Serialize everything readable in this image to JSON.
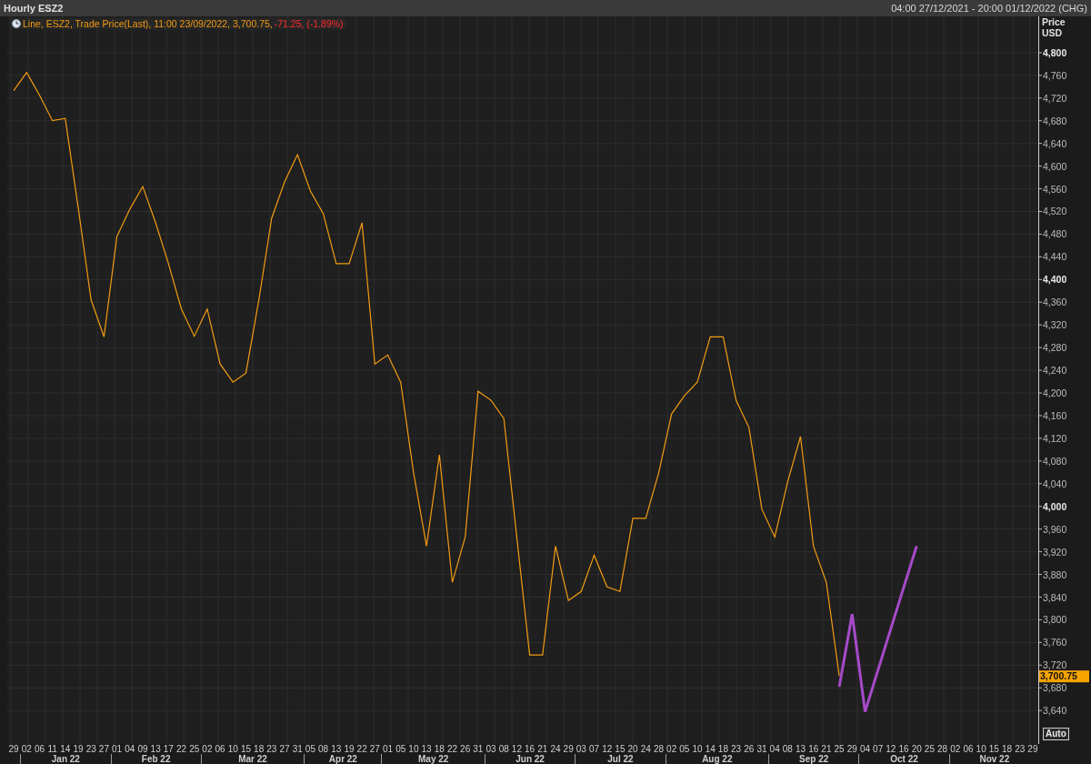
{
  "title_bar": {
    "title": "Hourly ESZ2",
    "range": "04:00 27/12/2021 - 20:00 01/12/2022 (CHG)"
  },
  "legend": {
    "text": "Line, ESZ2, Trade Price(Last),  11:00 23/09/2022, 3,700.75,",
    "change": "-71.25, (-1.89%)"
  },
  "axis_header": [
    "Price",
    "USD"
  ],
  "price_tag": "3,700.75",
  "auto_button": "Auto",
  "chart_data": {
    "type": "line",
    "grid": true,
    "ylim": [
      3581,
      4864
    ],
    "yticks": [
      {
        "value": 4800,
        "label": "4,800"
      },
      {
        "value": 4760,
        "label": "4,760"
      },
      {
        "value": 4720,
        "label": "4,720"
      },
      {
        "value": 4680,
        "label": "4,680"
      },
      {
        "value": 4640,
        "label": "4,640"
      },
      {
        "value": 4600,
        "label": "4,600"
      },
      {
        "value": 4560,
        "label": "4,560"
      },
      {
        "value": 4520,
        "label": "4,520"
      },
      {
        "value": 4480,
        "label": "4,480"
      },
      {
        "value": 4440,
        "label": "4,440"
      },
      {
        "value": 4400,
        "label": "4,400"
      },
      {
        "value": 4360,
        "label": "4,360"
      },
      {
        "value": 4320,
        "label": "4,320"
      },
      {
        "value": 4280,
        "label": "4,280"
      },
      {
        "value": 4240,
        "label": "4,240"
      },
      {
        "value": 4200,
        "label": "4,200"
      },
      {
        "value": 4160,
        "label": "4,160"
      },
      {
        "value": 4120,
        "label": "4,120"
      },
      {
        "value": 4080,
        "label": "4,080"
      },
      {
        "value": 4040,
        "label": "4,040"
      },
      {
        "value": 4000,
        "label": "4,000"
      },
      {
        "value": 3960,
        "label": "3,960"
      },
      {
        "value": 3920,
        "label": "3,920"
      },
      {
        "value": 3880,
        "label": "3,880"
      },
      {
        "value": 3840,
        "label": "3,840"
      },
      {
        "value": 3800,
        "label": "3,800"
      },
      {
        "value": 3760,
        "label": "3,760"
      },
      {
        "value": 3720,
        "label": "3,720"
      },
      {
        "value": 3680,
        "label": "3,680"
      },
      {
        "value": 3640,
        "label": "3,640"
      }
    ],
    "categories": [
      "29",
      "02",
      "06",
      "11",
      "14",
      "19",
      "23",
      "27",
      "01",
      "04",
      "09",
      "13",
      "17",
      "22",
      "25",
      "02",
      "06",
      "10",
      "15",
      "18",
      "23",
      "27",
      "31",
      "05",
      "08",
      "13",
      "19",
      "22",
      "27",
      "01",
      "05",
      "10",
      "13",
      "18",
      "22",
      "26",
      "31",
      "03",
      "08",
      "12",
      "16",
      "21",
      "24",
      "29",
      "03",
      "07",
      "12",
      "15",
      "20",
      "24",
      "28",
      "02",
      "05",
      "10",
      "14",
      "18",
      "23",
      "26",
      "31",
      "04",
      "08",
      "13",
      "16",
      "21",
      "25",
      "29",
      "04",
      "07",
      "12",
      "16",
      "20",
      "25",
      "28",
      "02",
      "06",
      "10",
      "15",
      "18",
      "23",
      "29"
    ],
    "series": [
      {
        "color": "#f39c12",
        "values": [
          4733,
          4765,
          4725,
          4680,
          4684,
          4527,
          4364,
          4299,
          4476,
          4524,
          4564,
          4500,
          4428,
          4348,
          4300,
          4348,
          4251,
          4219,
          4235,
          4364,
          4508,
          4572,
          4620,
          4556,
          4516,
          4428,
          4428,
          4500,
          4251,
          4267,
          4219,
          4059,
          3930,
          4091,
          3866,
          3946,
          4203,
          4187,
          4155,
          3946,
          3738,
          3738,
          3930,
          3834,
          3850,
          3914,
          3858,
          3850,
          3979,
          3979,
          4059,
          4163,
          4195,
          4219,
          4299,
          4299,
          4187,
          4139,
          3995,
          3946,
          4043,
          4123,
          3930,
          3866,
          3701,
          null,
          null,
          null,
          null,
          null,
          null,
          null,
          null,
          null,
          null,
          null,
          null,
          null,
          null,
          null
        ]
      },
      {
        "color": "#a64ac9",
        "values": [
          null,
          null,
          null,
          null,
          null,
          null,
          null,
          null,
          null,
          null,
          null,
          null,
          null,
          null,
          null,
          null,
          null,
          null,
          null,
          null,
          null,
          null,
          null,
          null,
          null,
          null,
          null,
          null,
          null,
          null,
          null,
          null,
          null,
          null,
          null,
          null,
          null,
          null,
          null,
          null,
          null,
          null,
          null,
          null,
          null,
          null,
          null,
          null,
          null,
          null,
          null,
          null,
          null,
          null,
          null,
          null,
          null,
          null,
          null,
          null,
          null,
          null,
          null,
          null,
          3682,
          3810,
          3638,
          3711,
          3784,
          3857,
          3930,
          null,
          null,
          null,
          null,
          null,
          null,
          null,
          null,
          null
        ]
      }
    ]
  },
  "x_axis": {
    "months": [
      "Jan 22",
      "Feb 22",
      "Mar 22",
      "Apr 22",
      "May 22",
      "Jun 22",
      "Jul 22",
      "Aug 22",
      "Sep 22",
      "Oct 22",
      "Nov 22"
    ]
  }
}
